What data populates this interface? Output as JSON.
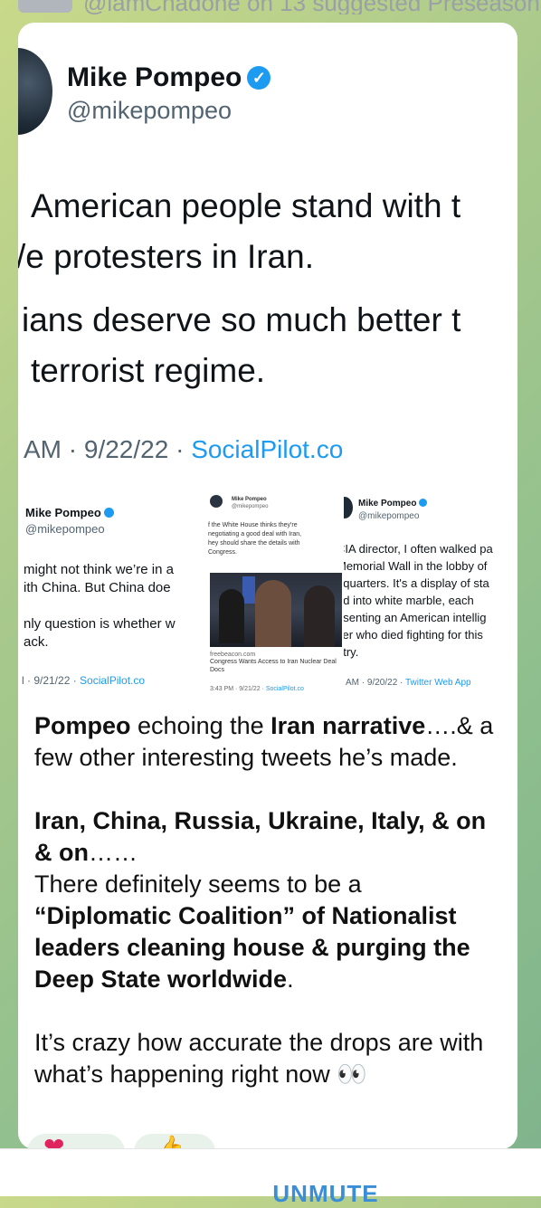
{
  "top_bar": {
    "text": "@iamChadone on 13 suggested Preseason"
  },
  "tweet": {
    "author_name": "Mike Pompeo",
    "author_handle": "@mikepompeo",
    "lines": [
      "American people stand with t",
      "/e protesters in Iran.",
      "ians deserve so much better t",
      "terrorist regime."
    ],
    "meta_time": "AM · 9/22/22 · ",
    "meta_source": "SocialPilot.co"
  },
  "thumbs": [
    {
      "author_name": "Mike Pompeo",
      "author_handle": "@mikepompeo",
      "lines": [
        "might not think we’re in a",
        "ith China. But China doe",
        "",
        "nly question is whether w",
        "ack."
      ],
      "meta_time": "l · 9/21/22 · ",
      "meta_source": "SocialPilot.co"
    },
    {
      "author_name": "Mike Pompeo",
      "author_handle": "@mikepompeo",
      "lines": [
        "f the White House thinks they're",
        "negotiating a good deal with Iran,",
        "hey should share the details with",
        "Congress."
      ],
      "link_domain": "freebeacon.com",
      "link_title": "Congress Wants Access to Iran Nuclear Deal Docs",
      "meta_time": "3:43 PM · 9/21/22 · ",
      "meta_source": "SocialPilot.co"
    },
    {
      "author_name": "Mike Pompeo",
      "author_handle": "@mikepompeo",
      "lines": [
        "CIA director, I often walked pa",
        "Memorial Wall in the lobby of",
        "dquarters. It's a display of sta",
        "ed into white marble, each",
        "esenting an American intellig",
        "cer who died fighting for this",
        "ntry."
      ],
      "meta_time": "AM · 9/20/22 · ",
      "meta_source": "Twitter Web App"
    }
  ],
  "message": {
    "p1": [
      {
        "t": "Pompeo",
        "b": true
      },
      {
        "t": " echoing the ",
        "b": false
      },
      {
        "t": "Iran narrative",
        "b": true
      },
      {
        "t": "….& a few other interesting tweets he’s made.",
        "b": false
      }
    ],
    "p2a": [
      {
        "t": "Iran, China, Russia, Ukraine, Italy, & on & on",
        "b": true
      },
      {
        "t": "……",
        "b": false
      }
    ],
    "p2b": [
      {
        "t": "There definitely seems to be a ",
        "b": false
      },
      {
        "t": "“Diplomatic Coalition” of Nationalist leaders cleaning house & purging the Deep State worldwide",
        "b": true
      },
      {
        "t": ".",
        "b": false
      }
    ],
    "p3": [
      {
        "t": "It’s crazy how accurate the drops are with what’s happening right now ",
        "b": false
      },
      {
        "t": "👀",
        "b": false
      }
    ]
  },
  "reactions": [
    {
      "icon": "heart-icon",
      "count": ""
    },
    {
      "icon": "thumbs-up-icon",
      "count": ""
    }
  ],
  "bottom_bar": {
    "action_label": "UNMUTE"
  },
  "colors": {
    "accent": "#1d9bf0",
    "unmute": "#3a8ed8",
    "bg": "#9cc68c"
  }
}
